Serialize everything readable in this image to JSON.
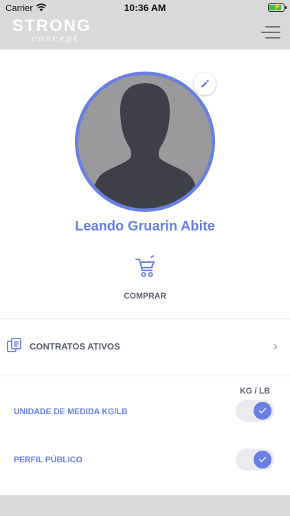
{
  "status_bar": {
    "carrier": "Carrier",
    "time": "10:36 AM"
  },
  "header": {
    "logo_main": "STRONG",
    "logo_sub": "concept",
    "menu_icon": "hamburger-menu-icon"
  },
  "profile": {
    "name": "Leando Gruarin Abite",
    "edit_icon": "pencil-icon",
    "avatar_icon": "person-silhouette-icon"
  },
  "buy": {
    "label": "COMPRAR",
    "icon": "shopping-cart-icon"
  },
  "contracts": {
    "label": "CONTRATOS ATIVOS",
    "icon": "documents-icon",
    "chevron": "›"
  },
  "settings": {
    "unit_header": "KG / LB",
    "items": [
      {
        "label": "UNIDADE DE MEDIDA KG/LB",
        "enabled": true
      },
      {
        "label": "PERFIL PÚBLICO",
        "enabled": true
      }
    ]
  },
  "colors": {
    "accent": "#6a7fe4",
    "header_bg": "#d9d9d9",
    "text_muted": "#5d6370",
    "battery": "#3fbf4a"
  }
}
